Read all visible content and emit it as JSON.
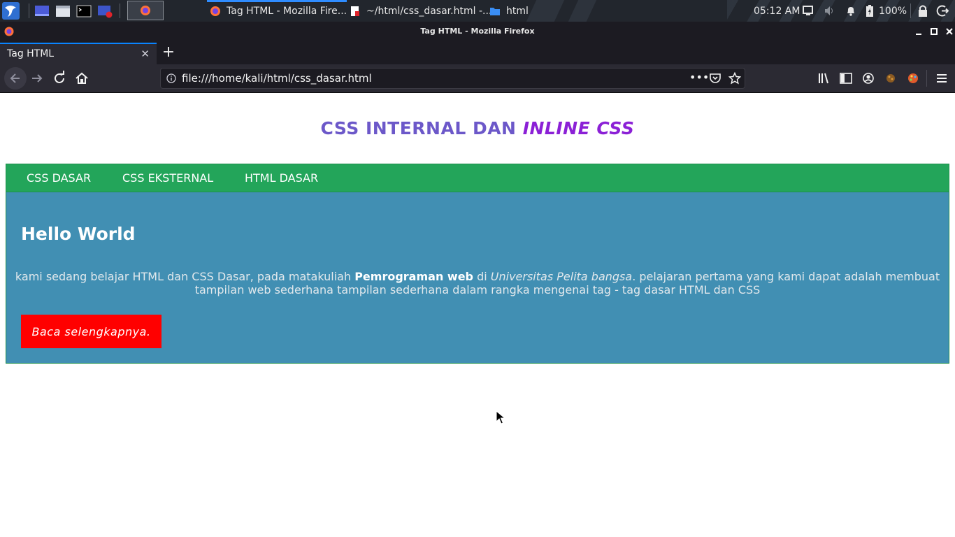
{
  "taskbar": {
    "tasks": [
      {
        "label": "Tag HTML - Mozilla Fire...",
        "icon": "firefox-icon"
      },
      {
        "label": "~/html/css_dasar.html -...",
        "icon": "text-file-icon"
      },
      {
        "label": "html",
        "icon": "folder-icon"
      }
    ],
    "clock": "05:12 AM",
    "battery": "100%"
  },
  "window": {
    "title": "Tag HTML - Mozilla Firefox"
  },
  "browser": {
    "tab_title": "Tag HTML",
    "url": "file:///home/kali/html/css_dasar.html"
  },
  "page": {
    "heading_plain": "CSS INTERNAL DAN",
    "heading_italic": "INLINE CSS",
    "nav": [
      "CSS DASAR",
      "CSS EKSTERNAL",
      "HTML DASAR"
    ],
    "hello": "Hello World",
    "paragraph": {
      "part1": "kami sedang belajar HTML dan CSS Dasar, pada matakuliah ",
      "bold": "Pemrograman web",
      "part2": " di ",
      "italic": "Universitas Pelita bangsa",
      "part3": ". pelajaran pertama yang kami dapat adalah membuat tampilan web sederhana tampilan sederhana dalam rangka mengenai tag - tag dasar HTML dan CSS"
    },
    "button": "Baca selengkapnya."
  },
  "colors": {
    "heading": "#6c58c9",
    "heading_italic": "#8b20d6",
    "nav_bg": "#23a55a",
    "content_bg": "#418fb3",
    "button_bg": "#ff0000"
  }
}
